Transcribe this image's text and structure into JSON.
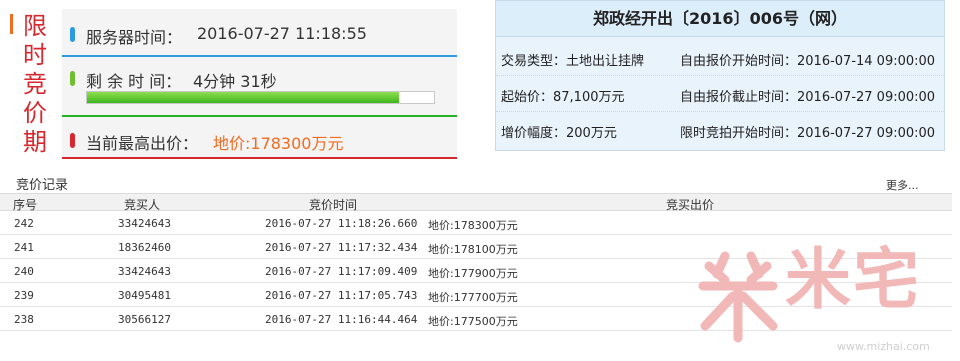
{
  "phase_label": "限时竞价期",
  "status": {
    "server_time_label": "服务器时间：",
    "server_time_value": "2016-07-27  11:18:55",
    "remaining_label": "剩 余 时 间：",
    "remaining_value": "4分钟 31秒",
    "remaining_progress": 0.9,
    "highest_label": "当前最高出价：",
    "highest_value": "地价:178300万元"
  },
  "info": {
    "title": "郑政经开出〔2016〕006号（网）",
    "trade_type": "交易类型：土地出让挂牌",
    "free_start": "自由报价开始时间：2016-07-14 09:00:00",
    "start_price": "起始价：87,100万元",
    "free_end": "自由报价截止时间：2016-07-27 09:00:00",
    "increment": "增价幅度：200万元",
    "limit_start": "限时竞拍开始时间：2016-07-27 09:00:00"
  },
  "records": {
    "title": "竞价记录",
    "more": "更多...",
    "headers": [
      "序号",
      "竞买人",
      "竞价时间",
      "竞买出价"
    ],
    "rows": [
      [
        "242",
        "33424643",
        "2016-07-27 11:18:26.660",
        "地价:178300万元"
      ],
      [
        "241",
        "18362460",
        "2016-07-27 11:17:32.434",
        "地价:178100万元"
      ],
      [
        "240",
        "33424643",
        "2016-07-27 11:17:09.409",
        "地价:177900万元"
      ],
      [
        "239",
        "30495481",
        "2016-07-27 11:17:05.743",
        "地价:177700万元"
      ],
      [
        "238",
        "30566127",
        "2016-07-27 11:16:44.464",
        "地价:177500万元"
      ]
    ]
  },
  "watermark": {
    "brand": "米宅",
    "url": "www.mizhai.com",
    "logo_icon": "mizhai-logo-icon"
  },
  "colors": {
    "accent_red": "#d7282f",
    "accent_orange": "#f26b21",
    "accent_blue": "#2e9ae0",
    "accent_green": "#23b423"
  }
}
